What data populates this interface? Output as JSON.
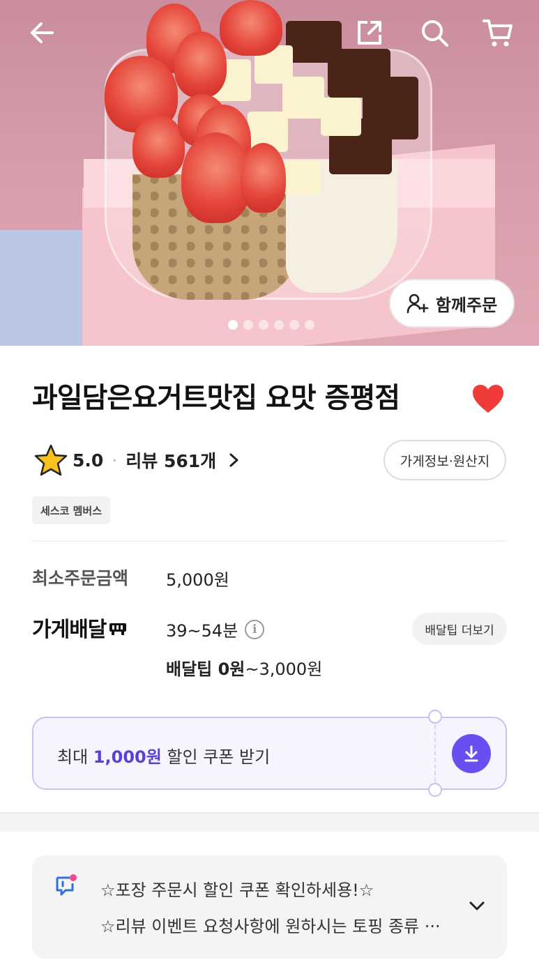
{
  "hero": {
    "group_order_label": "함께주문",
    "dots_count": 6,
    "active_dot": 0
  },
  "store": {
    "name": "과일담은요거트맛집 요맛 증평점",
    "rating": "5.0",
    "reviews_label": "리뷰 561개",
    "info_button": "가게정보·원산지",
    "member_badge": "세스코 멤버스",
    "favorited": true
  },
  "order_info": {
    "min_order_label": "최소주문금액",
    "min_order_value": "5,000원",
    "delivery_label": "가게배달",
    "delivery_time": "39~54분",
    "tip_more_button": "배달팁 더보기",
    "tip_bold": "배달팁 0원",
    "tip_rest": "~3,000원"
  },
  "coupon": {
    "prefix": "최대 ",
    "amount": "1,000원",
    "suffix": " 할인 쿠폰 받기"
  },
  "notice": {
    "line1": "☆포장 주문시 할인 쿠폰 확인하세용!☆",
    "line2": "☆리뷰 이벤트 요청사항에 원하시는 토핑 종류 ···"
  },
  "colors": {
    "accent": "#6a4ef0",
    "heart": "#f03b3b",
    "star": "#f7c21b"
  },
  "icons": [
    "back-arrow-icon",
    "share-icon",
    "search-icon",
    "cart-icon",
    "add-person-icon",
    "star-icon",
    "chevron-right-icon",
    "info-icon",
    "heart-icon",
    "download-icon",
    "notice-icon",
    "chevron-down-icon"
  ]
}
